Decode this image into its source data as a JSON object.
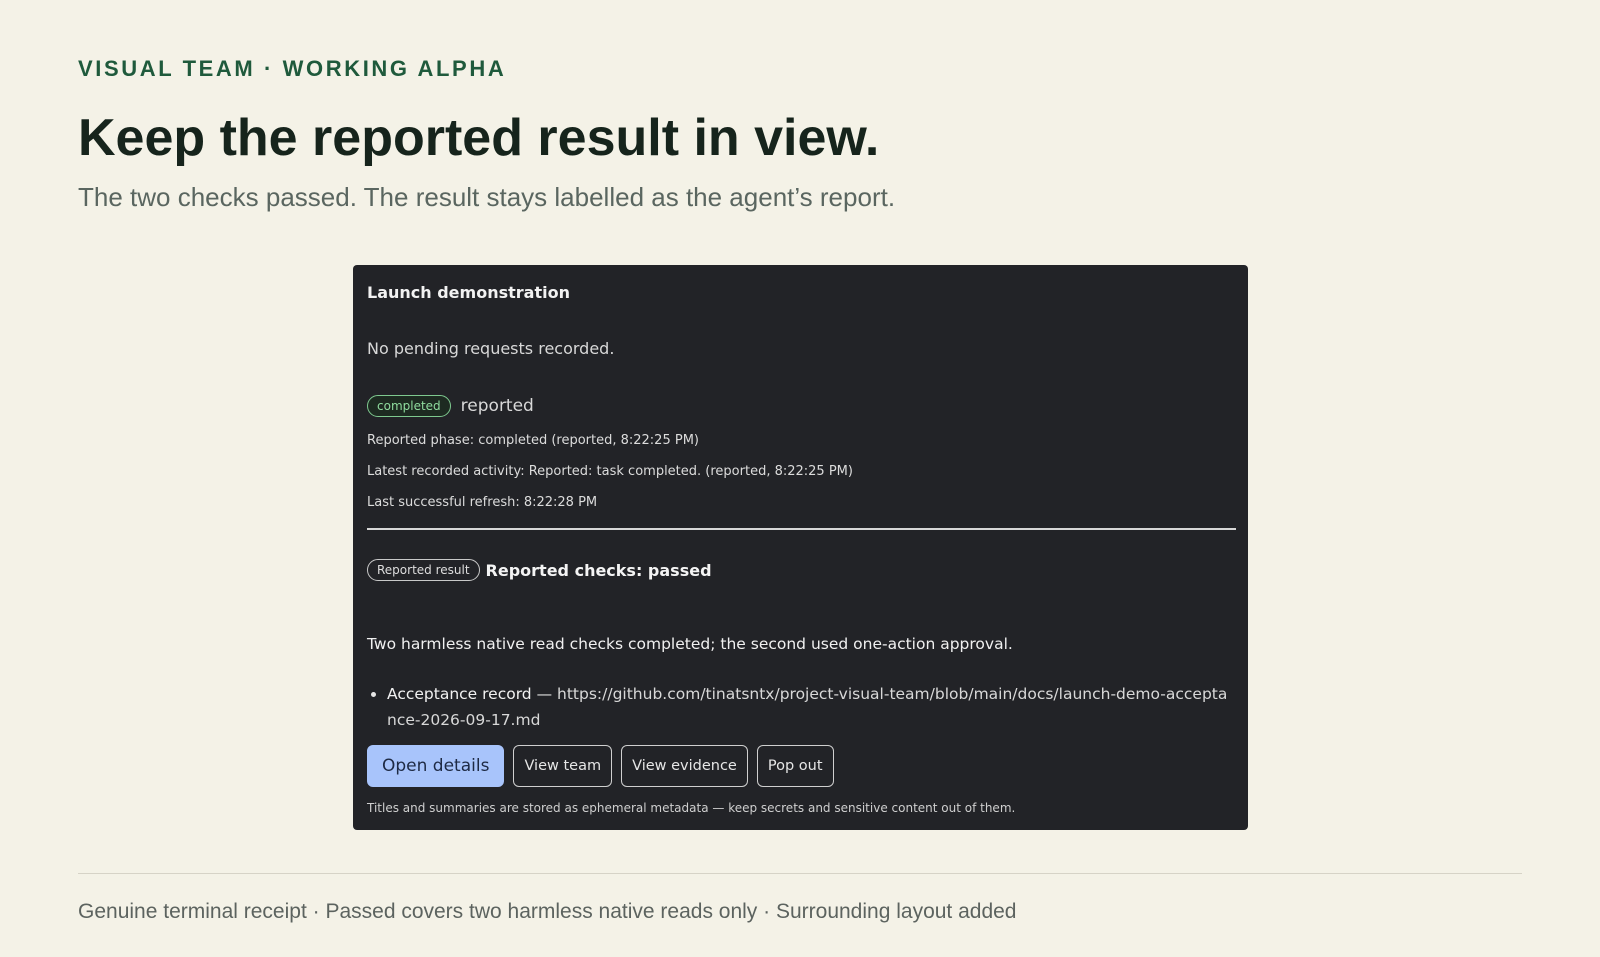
{
  "header": {
    "eyebrow": "VISUAL TEAM · WORKING ALPHA",
    "title": "Keep the reported result in view.",
    "subtitle": "The two checks passed. The result stays labelled as the agent’s report."
  },
  "panel": {
    "title": "Launch demonstration",
    "pending_text": "No pending requests recorded.",
    "status": {
      "badge": "completed",
      "qualifier": "reported"
    },
    "meta": {
      "phase": "Reported phase: completed (reported, 8:22:25 PM)",
      "activity": "Latest recorded activity: Reported: task completed. (reported, 8:22:25 PM)",
      "refresh": "Last successful refresh: 8:22:28 PM"
    },
    "result": {
      "badge": "Reported result",
      "headline": "Reported checks: passed",
      "summary": "Two harmless native read checks completed; the second used one-action approval."
    },
    "evidence": [
      {
        "label": "Acceptance record",
        "separator": " — ",
        "url": "https://github.com/tinatsntx/project-visual-team/blob/main/docs/launch-demo-acceptance-2026-09-17.md"
      }
    ],
    "buttons": {
      "open_details": "Open details",
      "view_team": "View team",
      "view_evidence": "View evidence",
      "pop_out": "Pop out"
    },
    "footnote": "Titles and summaries are stored as ephemeral metadata — keep secrets and sensitive content out of them."
  },
  "footer": {
    "caption": "Genuine terminal receipt · Passed covers two harmless native reads only · Surrounding layout added"
  },
  "colors": {
    "page_background": "#f4f2e7",
    "eyebrow_green": "#1f5a3c",
    "panel_background": "#222327",
    "completed_badge": "#8fdc9e",
    "primary_button": "#a8c4fb"
  }
}
